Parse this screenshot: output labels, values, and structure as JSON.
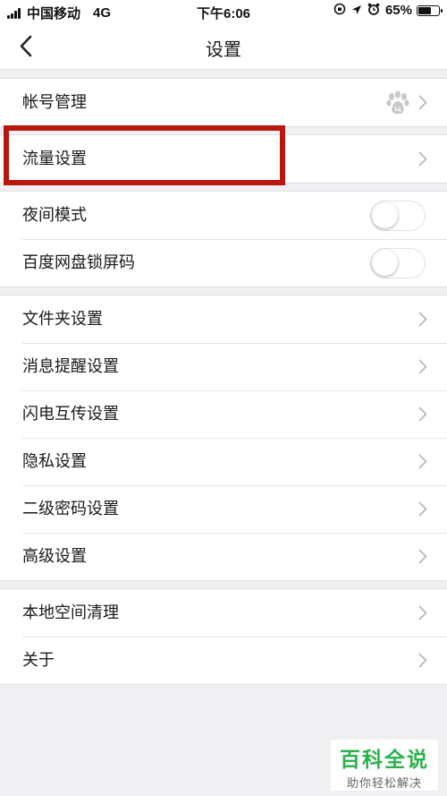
{
  "status_bar": {
    "carrier": "中国移动",
    "network": "4G",
    "time": "下午6:06",
    "battery_text": "65%",
    "battery_level": 0.65
  },
  "nav": {
    "title": "设置",
    "back_icon": "chevron-left-icon"
  },
  "groups": [
    {
      "items": [
        {
          "label": "帐号管理",
          "control": "chevron",
          "extra_icon": "baidu-paw-icon"
        }
      ]
    },
    {
      "items": [
        {
          "label": "流量设置",
          "control": "chevron",
          "highlighted": true
        }
      ]
    },
    {
      "items": [
        {
          "label": "夜间模式",
          "control": "toggle",
          "on": false
        },
        {
          "label": "百度网盘锁屏码",
          "control": "toggle",
          "on": false
        }
      ]
    },
    {
      "items": [
        {
          "label": "文件夹设置",
          "control": "chevron"
        },
        {
          "label": "消息提醒设置",
          "control": "chevron"
        },
        {
          "label": "闪电互传设置",
          "control": "chevron"
        },
        {
          "label": "隐私设置",
          "control": "chevron"
        },
        {
          "label": "二级密码设置",
          "control": "chevron"
        },
        {
          "label": "高级设置",
          "control": "chevron"
        }
      ]
    },
    {
      "items": [
        {
          "label": "本地空间清理",
          "control": "chevron"
        },
        {
          "label": "关于",
          "control": "chevron"
        }
      ]
    }
  ],
  "annotation": {
    "highlight_color": "#b8170f"
  },
  "watermark": {
    "title": "百科全说",
    "subtitle": "助你轻松解决",
    "color": "#2bb24c"
  }
}
